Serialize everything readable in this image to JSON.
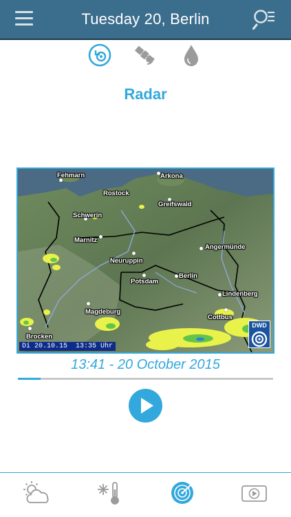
{
  "header": {
    "title": "Tuesday 20, Berlin",
    "menu_icon": "hamburger-menu-icon",
    "search_icon": "search-list-icon"
  },
  "modes": [
    {
      "icon": "radar-history-icon",
      "active": true
    },
    {
      "icon": "satellite-icon",
      "active": false
    },
    {
      "icon": "rain-drop-icon",
      "active": false
    }
  ],
  "section_title": "Radar",
  "map": {
    "stamp": "Di 20.10.15  13:35 Uhr",
    "logo_text": "DWD",
    "cities": [
      "Fehmarn",
      "Arkona",
      "Rostock",
      "Greifswald",
      "Schwerin",
      "Marnitz",
      "Angermünde",
      "Neuruppin",
      "Berlin",
      "Potsdam",
      "Lindenberg",
      "Magdeburg",
      "Cottbus",
      "Brocken"
    ]
  },
  "timestamp": "13:41 - 20 October 2015",
  "progress": 0.09,
  "play_icon": "play-icon",
  "tabs": [
    {
      "icon": "weather-cloud-sun-icon",
      "active": false
    },
    {
      "icon": "snow-thermometer-icon",
      "active": false
    },
    {
      "icon": "radar-icon",
      "active": true
    },
    {
      "icon": "video-play-icon",
      "active": false
    }
  ],
  "colors": {
    "header_bg": "#3b6d8d",
    "accent": "#33a8dc",
    "icon_gray": "#9b9b9b"
  }
}
